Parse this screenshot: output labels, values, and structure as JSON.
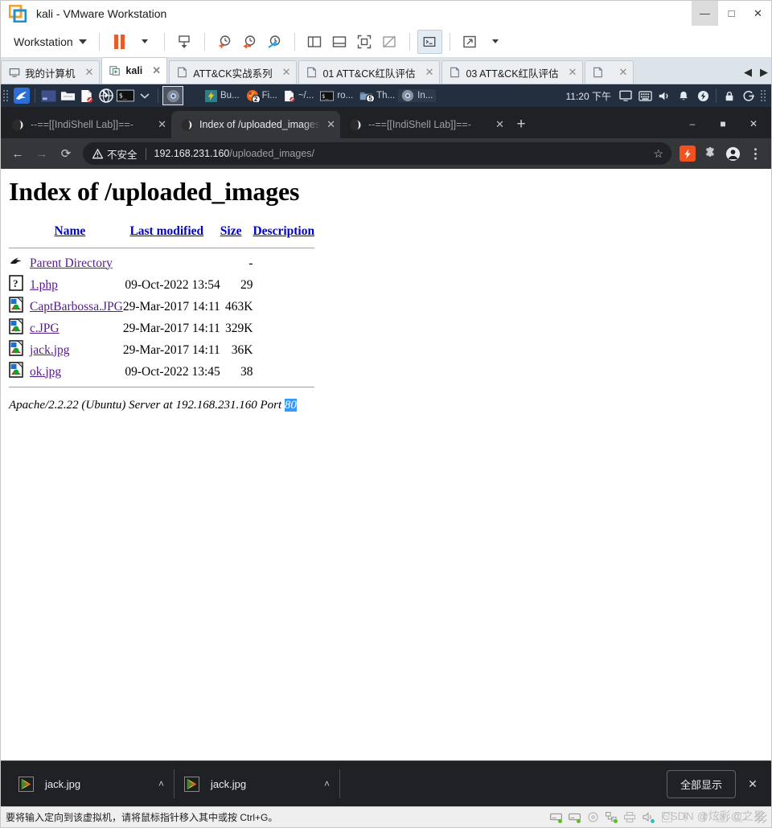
{
  "vmware": {
    "title": "kali - VMware Workstation",
    "logo_icon": "vmware-logo-icon",
    "window_controls": [
      {
        "name": "minimize",
        "glyph": "—"
      },
      {
        "name": "maximize",
        "glyph": "□"
      },
      {
        "name": "close",
        "glyph": "✕"
      }
    ],
    "toolbar": {
      "workstation_label": "Workstation",
      "buttons": [
        {
          "name": "pause-vm",
          "icon": "pause-icon"
        },
        {
          "name": "pause-dropdown",
          "icon": "chevron-down-icon"
        },
        {
          "name": "send-ctrl-alt-del",
          "icon": "send-key-icon"
        },
        {
          "name": "take-snapshot",
          "icon": "snapshot-add-icon"
        },
        {
          "name": "revert-snapshot",
          "icon": "snapshot-revert-icon"
        },
        {
          "name": "manage-snapshots",
          "icon": "snapshot-manage-icon"
        },
        {
          "name": "show-library",
          "icon": "panel-left-icon"
        },
        {
          "name": "show-thumbnail-bar",
          "icon": "panel-bottom-icon"
        },
        {
          "name": "full-screen",
          "icon": "fullscreen-icon"
        },
        {
          "name": "unity-mode",
          "icon": "unity-off-icon"
        },
        {
          "name": "console-view",
          "icon": "console-icon"
        },
        {
          "name": "stretch-guest",
          "icon": "stretch-icon"
        },
        {
          "name": "stretch-dropdown",
          "icon": "chevron-down-icon"
        }
      ]
    },
    "tabs": [
      {
        "label": "我的计算机",
        "icon": "monitor-icon",
        "selected": false,
        "closable": true
      },
      {
        "label": "kali",
        "icon": "vm-running-icon",
        "selected": true,
        "closable": true
      },
      {
        "label": "ATT&CK实战系列",
        "icon": "folder-tab-icon",
        "selected": false,
        "closable": true
      },
      {
        "label": "01 ATT&CK红队评估",
        "icon": "folder-tab-icon",
        "selected": false,
        "closable": true
      },
      {
        "label": "03 ATT&CK红队评估",
        "icon": "folder-tab-icon",
        "selected": false,
        "closable": true
      },
      {
        "label": "",
        "icon": "folder-tab-icon",
        "selected": false,
        "closable": true
      }
    ],
    "tab_nav": {
      "prev": "◀",
      "next": "▶"
    },
    "status_text": "要将输入定向到该虚拟机，请将鼠标指针移入其中或按 Ctrl+G。",
    "status_icons": [
      {
        "name": "hard-disk-1-icon",
        "active": true
      },
      {
        "name": "hard-disk-2-icon",
        "active": true
      },
      {
        "name": "cd-dvd-icon",
        "active": false
      },
      {
        "name": "network-adapter-icon",
        "active": true
      },
      {
        "name": "printer-icon",
        "active": false
      },
      {
        "name": "sound-card-icon",
        "active": true
      },
      {
        "name": "floppy-icon",
        "active": false
      },
      {
        "name": "usb-icon",
        "active": false
      },
      {
        "name": "bluetooth-icon",
        "active": false
      },
      {
        "name": "camera-icon",
        "active": false
      },
      {
        "name": "display-icon",
        "active": false
      }
    ],
    "watermark": "CSDN @炫彩@之星"
  },
  "kali_panel": {
    "app_menu_icon": "kali-dragon-icon",
    "launchers": [
      {
        "name": "workspace-switcher-icon"
      },
      {
        "name": "file-manager-icon"
      },
      {
        "name": "text-editor-icon"
      },
      {
        "name": "web-browser-icon"
      },
      {
        "name": "terminal-icon"
      },
      {
        "name": "terminal-dropdown-icon"
      }
    ],
    "active_launcher": {
      "name": "chrome-icon"
    },
    "tasks": [
      {
        "label": "Bu...",
        "icon": "burpsuite-icon",
        "badge": ""
      },
      {
        "label": "Fi...",
        "icon": "firefox-icon",
        "badge": "2"
      },
      {
        "label": "~/...",
        "icon": "text-editor-icon",
        "badge": ""
      },
      {
        "label": "ro...",
        "icon": "terminal-icon",
        "badge": ""
      },
      {
        "label": "Th...",
        "icon": "file-manager-icon",
        "badge": "5"
      },
      {
        "label": "In...",
        "icon": "chrome-icon",
        "badge": "",
        "active": true
      }
    ],
    "clock": "11:20 下午",
    "tray": [
      {
        "name": "display-settings-icon"
      },
      {
        "name": "keyboard-layout-icon"
      },
      {
        "name": "volume-icon"
      },
      {
        "name": "notifications-icon"
      },
      {
        "name": "power-manager-icon"
      },
      {
        "name": "lock-screen-icon"
      },
      {
        "name": "log-out-icon"
      },
      {
        "name": "panel-grip-icon"
      }
    ]
  },
  "browser": {
    "tabs": [
      {
        "title": "--==[[IndiShell Lab]]==-",
        "favicon": "globe-icon",
        "selected": false
      },
      {
        "title": "Index of /uploaded_images",
        "favicon": "globe-icon",
        "selected": true
      },
      {
        "title": "--==[[IndiShell Lab]]==-",
        "favicon": "globe-icon",
        "selected": false
      }
    ],
    "new_tab_glyph": "+",
    "window_controls": [
      {
        "name": "minimize",
        "glyph": "–"
      },
      {
        "name": "maximize",
        "glyph": "■"
      },
      {
        "name": "close",
        "glyph": "✕"
      }
    ],
    "nav": {
      "back": "←",
      "forward": "→",
      "reload": "⟳"
    },
    "omnibox": {
      "security_label": "不安全",
      "security_icon": "warning-triangle-icon",
      "url_host": "192.168.231.160",
      "url_path": "/uploaded_images/",
      "bookmark_icon": "star-icon"
    },
    "toolbar_right": [
      {
        "name": "lightning-extension-icon"
      },
      {
        "name": "extensions-puzzle-icon"
      },
      {
        "name": "profile-avatar-icon"
      },
      {
        "name": "chrome-menu-icon"
      }
    ]
  },
  "page": {
    "heading": "Index of /uploaded_images",
    "columns": [
      {
        "label": "Name"
      },
      {
        "label": "Last modified"
      },
      {
        "label": "Size"
      },
      {
        "label": "Description"
      }
    ],
    "rows": [
      {
        "icon": "parent-directory-icon",
        "name": "Parent Directory",
        "modified": "",
        "size": "-",
        "description": ""
      },
      {
        "icon": "unknown-file-icon",
        "name": "1.php",
        "modified": "09-Oct-2022 13:54",
        "size": "29",
        "description": ""
      },
      {
        "icon": "image-file-icon",
        "name": "CaptBarbossa.JPG",
        "modified": "29-Mar-2017 14:11",
        "size": "463K",
        "description": ""
      },
      {
        "icon": "image-file-icon",
        "name": "c.JPG",
        "modified": "29-Mar-2017 14:11",
        "size": "329K",
        "description": ""
      },
      {
        "icon": "image-file-icon",
        "name": "jack.jpg",
        "modified": "29-Mar-2017 14:11",
        "size": "36K",
        "description": ""
      },
      {
        "icon": "image-file-icon",
        "name": "ok.jpg",
        "modified": "09-Oct-2022 13:45",
        "size": "38",
        "description": ""
      }
    ],
    "footer_prefix": "Apache/2.2.22 (Ubuntu) Server at 192.168.231.160 Port ",
    "footer_selected": "80"
  },
  "download_shelf": {
    "items": [
      {
        "name": "jack.jpg",
        "icon": "image-thumb-icon",
        "menu_glyph": "˄"
      },
      {
        "name": "jack.jpg",
        "icon": "image-thumb-icon",
        "menu_glyph": "˄"
      }
    ],
    "show_all_label": "全部显示",
    "close_glyph": "✕"
  },
  "colors": {
    "vmware_accent": "#eb5b26",
    "kali_panel_bg": "#232f3e",
    "chrome_bg": "#202124",
    "chrome_tab_sel": "#35363a",
    "link": "#551a8b",
    "header_link": "#0000cc",
    "selection": "#3399ff",
    "ext_orange": "#f4511e"
  }
}
